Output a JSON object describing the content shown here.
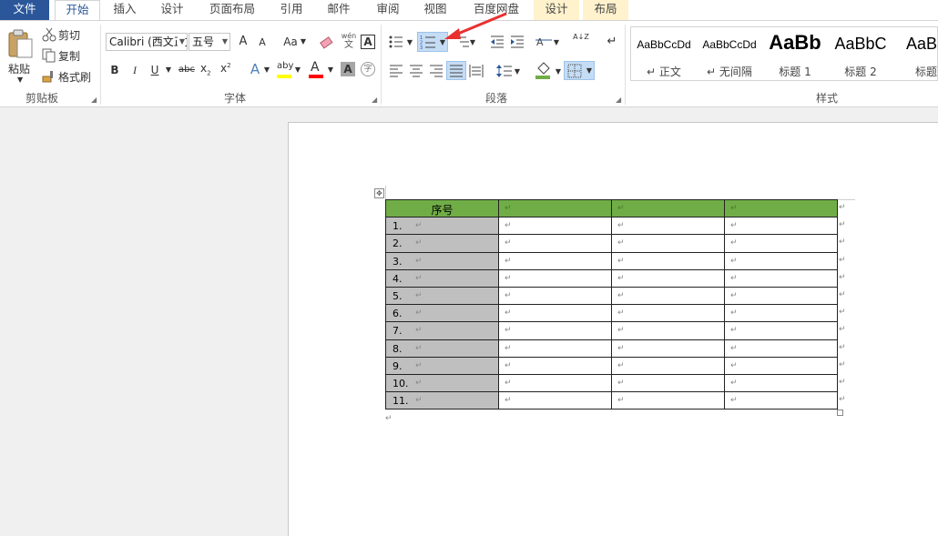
{
  "tabs": [
    "文件",
    "开始",
    "插入",
    "设计",
    "页面布局",
    "引用",
    "邮件",
    "审阅",
    "视图",
    "百度网盘",
    "设计",
    "布局"
  ],
  "clipboard": {
    "paste": "粘贴",
    "cut": "剪切",
    "copy": "复制",
    "format_painter": "格式刷",
    "label": "剪贴板"
  },
  "font": {
    "family": "Calibri (西文正文)",
    "size": "五号",
    "grow": "A",
    "shrink": "A",
    "case": "Aa",
    "phonetic_top": "wén",
    "phonetic_bottom": "文",
    "char_border": "A",
    "bold": "B",
    "italic": "I",
    "underline": "U",
    "strike": "abc",
    "subscript": "x",
    "superscript": "x",
    "sub_mark": "2",
    "sup_mark": "2",
    "text_effect": "A",
    "highlight": "aby",
    "font_color": "A",
    "char_shading": "A",
    "enclose": "字",
    "label": "字体"
  },
  "paragraph": {
    "label": "段落",
    "sort": "A↓Z",
    "show_marks": "↵"
  },
  "styles": {
    "label": "样式",
    "items": [
      {
        "sample": "AaBbCcDd",
        "name": "正文"
      },
      {
        "sample": "AaBbCcDd",
        "name": "无间隔"
      },
      {
        "sample": "AaBb",
        "name": "标题 1"
      },
      {
        "sample": "AaBbC",
        "name": "标题 2"
      },
      {
        "sample": "AaBb",
        "name": "标题"
      }
    ]
  },
  "table": {
    "header": "序号",
    "rows": [
      "1.",
      "2.",
      "3.",
      "4.",
      "5.",
      "6.",
      "7.",
      "8.",
      "9.",
      "10.",
      "11."
    ],
    "para_mark": "↵",
    "header_color": "#70ad47",
    "index_color": "#bfbfbf"
  },
  "colors": {
    "accent": "#2b579a",
    "context_tab": "#fff2cc",
    "arrow": "#e8312f"
  }
}
